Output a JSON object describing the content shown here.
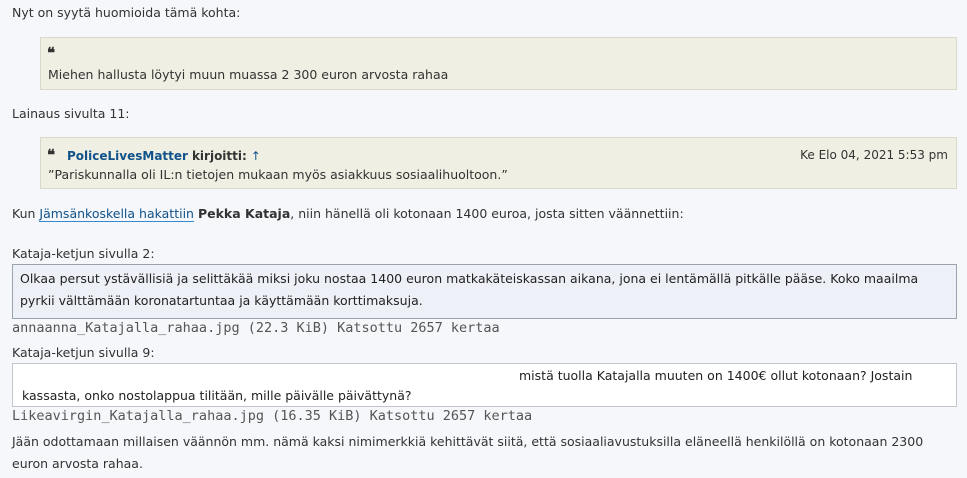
{
  "post": {
    "intro": "Nyt on syytä huomioida tämä kohta:",
    "quote1": {
      "icon": "quote-icon",
      "text": "Miehen hallusta löytyi muun muassa 2 300 euron arvosta rahaa"
    },
    "source_line": "Lainaus sivulta 11:",
    "quote2": {
      "icon": "quote-icon",
      "author": "PoliceLivesMatter",
      "wrote": "kirjoitti:",
      "arrow": "↑",
      "date": "Ke Elo 04, 2021 5:53 pm",
      "text": "”Pariskunnalla oli IL:n tietojen mukaan myös asiakkuus sosiaalihuoltoon.”"
    },
    "para1": {
      "prefix": "Kun ",
      "link": "Jämsänkoskella hakattiin",
      "space": " ",
      "bold": "Pekka Kataja",
      "suffix": ", niin hänellä oli kotonaan 1400 euroa, josta sitten väännettiin:"
    },
    "label1": "Kataja-ketjun sivulla 2:",
    "image1": {
      "line1": "Olkaa persut ystävällisiä ja selittäkää miksi joku nostaa 1400 euron matkakäteiskassan aikana, jona ei lentämällä pitkälle pääse. Koko maailma",
      "line2": "pyrkii välttämään koronatartuntaa ja käyttämään korttimaksuja."
    },
    "attach1": "annaanna_Katajalla_rahaa.jpg (22.3 KiB) Katsottu 2657 kertaa",
    "label2": "Kataja-ketjun sivulla 9:",
    "image2": {
      "line1": "mistä tuolla Katajalla muuten on 1400€ ollut kotonaan? Jostain",
      "line2": "kassasta, onko nostolappua tilitään, mille päivälle päivättynä?"
    },
    "attach2": "Likeavirgin_Katajalla_rahaa.jpg (16.35 KiB) Katsottu 2657 kertaa",
    "outro": {
      "line1": "Jään odottamaan millaisen väännön mm. nämä kaksi nimimerkkiä kehittävät siitä, että sosiaaliavustuksilla eläneellä henkilöllä on kotonaan 2300",
      "line2": "euron arvosta rahaa."
    }
  }
}
